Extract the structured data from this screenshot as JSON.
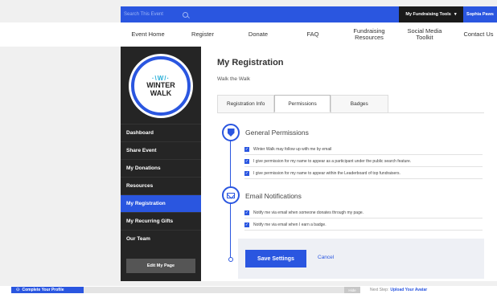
{
  "topbar": {
    "search_placeholder": "Search This Event",
    "tools_label": "My Fundraising Tools",
    "tools_caret": "▾",
    "user_name": "Sophia Paws"
  },
  "nav": {
    "items": [
      "Event Home",
      "Register",
      "Donate",
      "FAQ",
      "Fundraising Resources",
      "Social Media Toolkit",
      "Contact Us"
    ]
  },
  "logo": {
    "mark": "·\\W/·",
    "line1": "WINTER",
    "line2": "WALK"
  },
  "sidebar": {
    "items": [
      "Dashboard",
      "Share Event",
      "My Donations",
      "Resources",
      "My Registration",
      "My Recurring Gifts",
      "Our Team"
    ],
    "active_index": 4,
    "edit_button": "Edit My Page"
  },
  "main": {
    "title": "My Registration",
    "subtitle": "Walk the Walk",
    "tabs": [
      "Registration Info",
      "Permissions",
      "Badges"
    ],
    "active_tab": 1,
    "general": {
      "title": "General Permissions",
      "items": [
        "Winter Walk may follow up with me by email",
        "I give permission for my name to appear as a participant under the public search feature.",
        "I give permission for my name to appear within the Leaderboard of top fundraisers."
      ]
    },
    "email": {
      "title": "Email Notifications",
      "items": [
        "Notify me via email when someone donates through my page.",
        "Notify me via email when I earn a badge."
      ]
    },
    "save_label": "Save Settings",
    "cancel_label": "Cancel"
  },
  "bottom": {
    "profile_label": "Complete Your Profile",
    "profile_icon": "user-icon",
    "progress_label": "Hide",
    "next_prefix": "Next Step:",
    "next_link": "Upload Your Avatar"
  },
  "colors": {
    "accent": "#2a56e0",
    "sidebar": "#252525"
  }
}
